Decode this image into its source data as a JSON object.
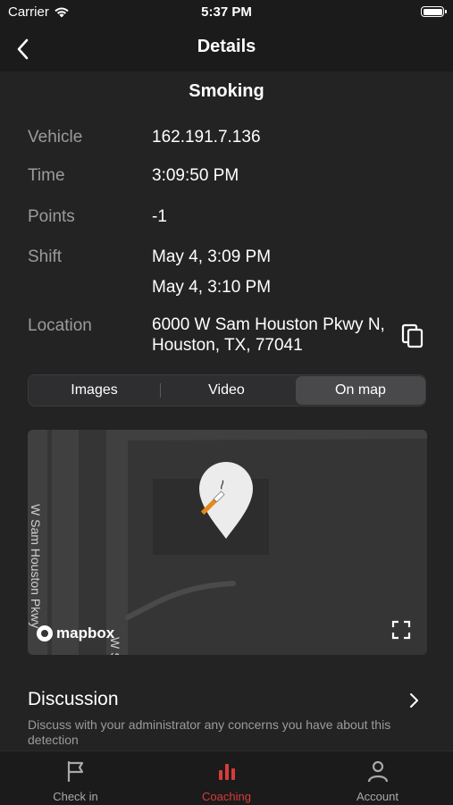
{
  "status_bar": {
    "carrier": "Carrier",
    "time": "5:37 PM"
  },
  "nav": {
    "title": "Details",
    "back_icon": "chevron-left-icon"
  },
  "event": {
    "title": "Smoking",
    "fields": {
      "vehicle": {
        "label": "Vehicle",
        "value": "162.191.7.136"
      },
      "time": {
        "label": "Time",
        "value": "3:09:50 PM"
      },
      "points": {
        "label": "Points",
        "value": "-1"
      },
      "shift": {
        "label": "Shift",
        "start": "May 4, 3:09 PM",
        "end": "May 4, 3:10 PM"
      },
      "location": {
        "label": "Location",
        "value": "6000 W Sam Houston Pkwy N, Houston, TX, 77041"
      }
    }
  },
  "segmented": {
    "options": [
      "Images",
      "Video",
      "On map"
    ],
    "selected": "On map"
  },
  "map": {
    "street_labels": [
      "W Sam Houston Pkwy",
      "W S"
    ],
    "logo_text": "mapbox",
    "marker_icon": "cigarette-icon"
  },
  "discussion": {
    "title": "Discussion",
    "description": "Discuss with your administrator any concerns you have about this detection"
  },
  "tabs": [
    {
      "label": "Check in",
      "icon": "flag-icon"
    },
    {
      "label": "Coaching",
      "icon": "bar-chart-icon",
      "active": true
    },
    {
      "label": "Account",
      "icon": "person-icon"
    }
  ],
  "colors": {
    "accent": "#d93b3b",
    "background": "#232323",
    "bar": "#1b1b1b"
  }
}
